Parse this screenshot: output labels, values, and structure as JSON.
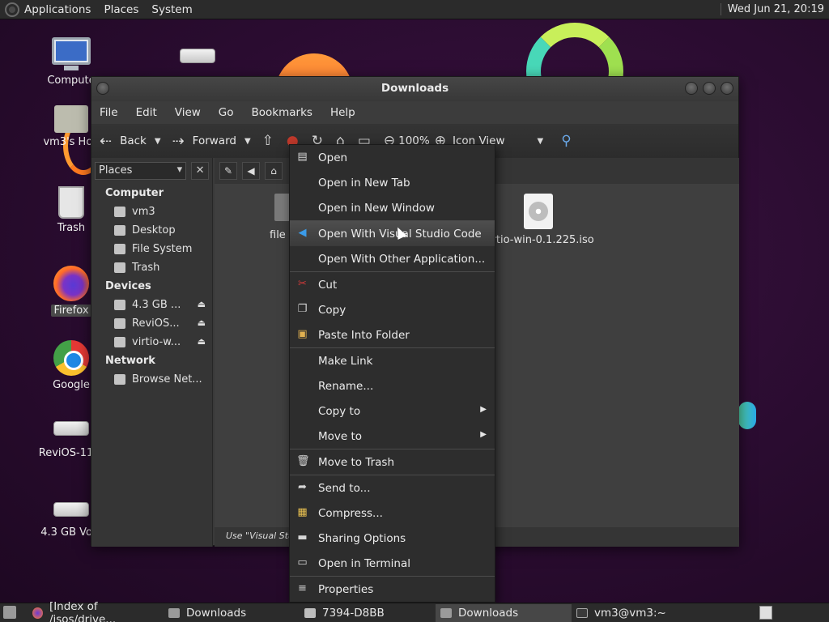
{
  "top_panel": {
    "menus": [
      "Applications",
      "Places",
      "System"
    ],
    "clock": "Wed Jun 21, 20:19"
  },
  "desktop_icons": [
    {
      "label": "Compute",
      "icon": "computer-icon"
    },
    {
      "label": "vm3's Hon",
      "icon": "home-folder-icon"
    },
    {
      "label": "Trash",
      "icon": "trash-icon"
    },
    {
      "label": "Firefox",
      "icon": "firefox-icon"
    },
    {
      "label": "Google",
      "icon": "chrome-icon"
    },
    {
      "label": "ReviOS-11-2",
      "icon": "drive-icon"
    },
    {
      "label": "4.3 GB Volu",
      "icon": "drive-icon"
    }
  ],
  "window": {
    "title": "Downloads",
    "menubar": [
      "File",
      "Edit",
      "View",
      "Go",
      "Bookmarks",
      "Help"
    ],
    "toolbar": {
      "back": "Back",
      "forward": "Forward",
      "zoom": "100%",
      "view_mode": "Icon View"
    },
    "sidebar": {
      "selector": "Places",
      "sections": [
        {
          "title": "Computer",
          "items": [
            "vm3",
            "Desktop",
            "File System",
            "Trash"
          ]
        },
        {
          "title": "Devices",
          "items": [
            "4.3 GB ...",
            "ReviOS...",
            "virtio-w..."
          ]
        },
        {
          "title": "Network",
          "items": [
            "Browse Net..."
          ]
        }
      ]
    },
    "files": [
      {
        "label": "file",
        "icon": "folder-icon"
      },
      {
        "label": "virtio-win-0.1.225.iso",
        "icon": "disc-image-icon"
      }
    ],
    "status": "Use \"Visual Stud"
  },
  "context_menu": {
    "groups": [
      [
        {
          "label": "Open",
          "icon": "open-icon"
        },
        {
          "label": "Open in New Tab",
          "icon": ""
        },
        {
          "label": "Open in New Window",
          "icon": ""
        }
      ],
      [
        {
          "label": "Open With Visual Studio Code",
          "icon": "vscode-icon"
        },
        {
          "label": "Open With Other Application...",
          "icon": ""
        }
      ],
      [
        {
          "label": "Cut",
          "icon": "scissors-icon"
        },
        {
          "label": "Copy",
          "icon": "copy-icon"
        },
        {
          "label": "Paste Into Folder",
          "icon": "paste-icon"
        }
      ],
      [
        {
          "label": "Make Link",
          "icon": ""
        },
        {
          "label": "Rename...",
          "icon": ""
        },
        {
          "label": "Copy to",
          "icon": "",
          "submenu": true
        },
        {
          "label": "Move to",
          "icon": "",
          "submenu": true
        }
      ],
      [
        {
          "label": "Move to Trash",
          "icon": "trash-icon"
        }
      ],
      [
        {
          "label": "Send to...",
          "icon": "send-icon"
        },
        {
          "label": "Compress...",
          "icon": "archive-icon"
        },
        {
          "label": "Sharing Options",
          "icon": "share-folder-icon"
        },
        {
          "label": "Open in Terminal",
          "icon": "terminal-icon"
        }
      ],
      [
        {
          "label": "Properties",
          "icon": "properties-icon"
        }
      ]
    ]
  },
  "taskbar": {
    "tasks": [
      {
        "label": "[Index of /isos/drive...",
        "icon": "firefox-icon"
      },
      {
        "label": "Downloads",
        "icon": "folder-icon"
      },
      {
        "label": "7394-D8BB",
        "icon": "drive-icon"
      },
      {
        "label": "Downloads",
        "icon": "folder-icon",
        "active": true
      },
      {
        "label": "vm3@vm3:~",
        "icon": "terminal-icon"
      }
    ]
  }
}
